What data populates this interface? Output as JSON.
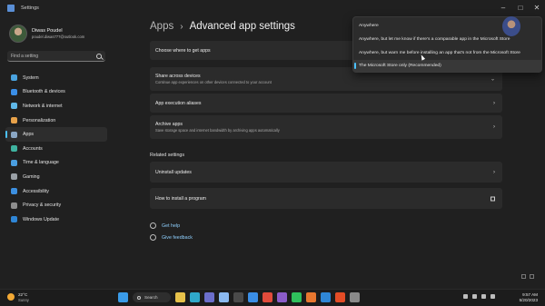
{
  "window": {
    "title": "Settings"
  },
  "profile": {
    "name": "Diwas Poudel",
    "email": "poudel.diwas777@outlook.com"
  },
  "search": {
    "placeholder": "Find a setting"
  },
  "sidebar": {
    "items": [
      {
        "label": "System",
        "icon": "monitor-icon",
        "color": "#4aa3df"
      },
      {
        "label": "Bluetooth & devices",
        "icon": "bluetooth-icon",
        "color": "#3a8ee6"
      },
      {
        "label": "Network & internet",
        "icon": "wifi-icon",
        "color": "#5fb8e8"
      },
      {
        "label": "Personalization",
        "icon": "brush-icon",
        "color": "#e8a24a"
      },
      {
        "label": "Apps",
        "icon": "apps-icon",
        "color": "#8aa6c4",
        "active": true
      },
      {
        "label": "Accounts",
        "icon": "person-icon",
        "color": "#3fb3a0"
      },
      {
        "label": "Time & language",
        "icon": "globe-clock-icon",
        "color": "#4a9ee0"
      },
      {
        "label": "Gaming",
        "icon": "gamepad-icon",
        "color": "#9aa0a6"
      },
      {
        "label": "Accessibility",
        "icon": "accessibility-icon",
        "color": "#3c8fe0"
      },
      {
        "label": "Privacy & security",
        "icon": "shield-icon",
        "color": "#8e8e8e"
      },
      {
        "label": "Windows Update",
        "icon": "update-icon",
        "color": "#2f86d6"
      }
    ]
  },
  "breadcrumb": {
    "parent": "Apps",
    "separator": "›",
    "current": "Advanced app settings"
  },
  "cards": {
    "choose": {
      "title": "Choose where to get apps"
    },
    "share": {
      "title": "Share across devices",
      "desc": "Continue app experiences on other devices connected to your account"
    },
    "aliases": {
      "title": "App execution aliases"
    },
    "archive": {
      "title": "Archive apps",
      "desc": "Save storage space and internet bandwidth by archiving apps automatically"
    }
  },
  "related": {
    "heading": "Related settings",
    "uninstall": {
      "title": "Uninstall updates"
    },
    "howto": {
      "title": "How to install a program"
    }
  },
  "help": {
    "get_help": "Get help",
    "feedback": "Give feedback"
  },
  "dropdown": {
    "options": [
      "Anywhere",
      "Anywhere, but let me know if there's a comparable app in the Microsoft Store",
      "Anywhere, but warn me before installing an app that's not from the Microsoft Store",
      "The Microsoft Store only (Recommended)"
    ],
    "selected_index": 3
  },
  "taskbar": {
    "weather": {
      "temp": "22°C",
      "condition": "Sunny"
    },
    "search_label": "Search",
    "apps": [
      {
        "icon": "start-icon",
        "color": "#3a9be8"
      },
      {
        "icon": "file-explorer-icon",
        "color": "#e6c14a"
      },
      {
        "icon": "edge-icon",
        "color": "#2fa8c9"
      },
      {
        "icon": "teams-icon",
        "color": "#6b6ecb"
      },
      {
        "icon": "photos-icon",
        "color": "#8bb9f0"
      },
      {
        "icon": "terminal-icon",
        "color": "#4a4a4a"
      },
      {
        "icon": "store-icon",
        "color": "#3a8ee6"
      },
      {
        "icon": "chrome-icon",
        "color": "#e14b3b"
      },
      {
        "icon": "visual-studio-icon",
        "color": "#8b5cc9"
      },
      {
        "icon": "spotify-icon",
        "color": "#2fbf5c"
      },
      {
        "icon": "firefox-icon",
        "color": "#e8772f"
      },
      {
        "icon": "vscode-icon",
        "color": "#2f86d6"
      },
      {
        "icon": "html-icon",
        "color": "#e34c26"
      },
      {
        "icon": "settings-icon",
        "color": "#8a8a8a"
      }
    ],
    "clock": {
      "time": "9:57 AM",
      "date": "5/20/2023"
    }
  }
}
